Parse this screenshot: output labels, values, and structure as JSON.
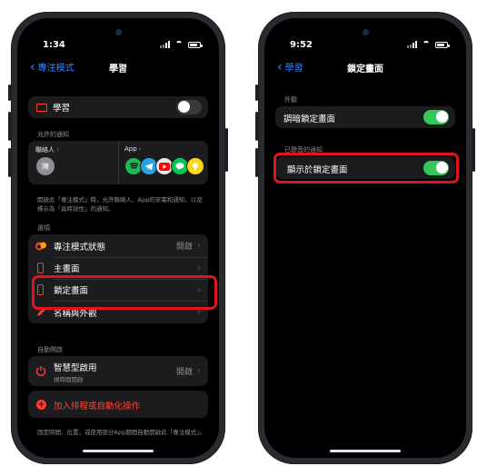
{
  "left": {
    "status": {
      "time": "1:34"
    },
    "nav": {
      "back_label": "專注模式",
      "title": "學習"
    },
    "focus_row": {
      "label": "學習",
      "toggle_on": false
    },
    "allowed": {
      "section": "允許的通知",
      "contacts_label": "聯絡人",
      "avatar_letter": "陳",
      "apps_label": "App",
      "app_icons": [
        "spotify-icon",
        "telegram-icon",
        "youtube-icon",
        "line-icon",
        "google-keep-icon"
      ]
    },
    "allowed_note": "開啟此「專注模式」時，允許聯絡人、App的來電和通知，以及標示為「具時效性」的通知。",
    "options": {
      "section": "選項",
      "items": [
        {
          "label": "專注模式狀態",
          "value": "開啟",
          "icon": "focus-status-icon"
        },
        {
          "label": "主畫面",
          "value": "",
          "icon": "home-screen-icon"
        },
        {
          "label": "鎖定畫面",
          "value": "",
          "icon": "lock-screen-icon"
        },
        {
          "label": "名稱與外觀",
          "value": "",
          "icon": "pencil-icon"
        }
      ]
    },
    "auto": {
      "section": "自動開啟",
      "smart_label": "智慧型啟用",
      "smart_sub": "視時間開啟",
      "smart_value": "開啟",
      "add_label": "加入排程或自動化操作"
    },
    "bottom_note": "固定時間、位置，或使用部分App期間自動開啟此「專注模式」。"
  },
  "right": {
    "status": {
      "time": "9:52"
    },
    "nav": {
      "back_label": "學習",
      "title": "鎖定畫面"
    },
    "appearance": {
      "section": "外觀",
      "label": "調暗鎖定畫面",
      "toggle_on": true
    },
    "silenced": {
      "section": "已靜音的通知",
      "label": "顯示於鎖定畫面",
      "toggle_on": true
    }
  },
  "colors": {
    "accent": "#3a86ff",
    "toggle_on": "#34c759",
    "highlight": "#e0141e",
    "destructive": "#ff3b30"
  }
}
